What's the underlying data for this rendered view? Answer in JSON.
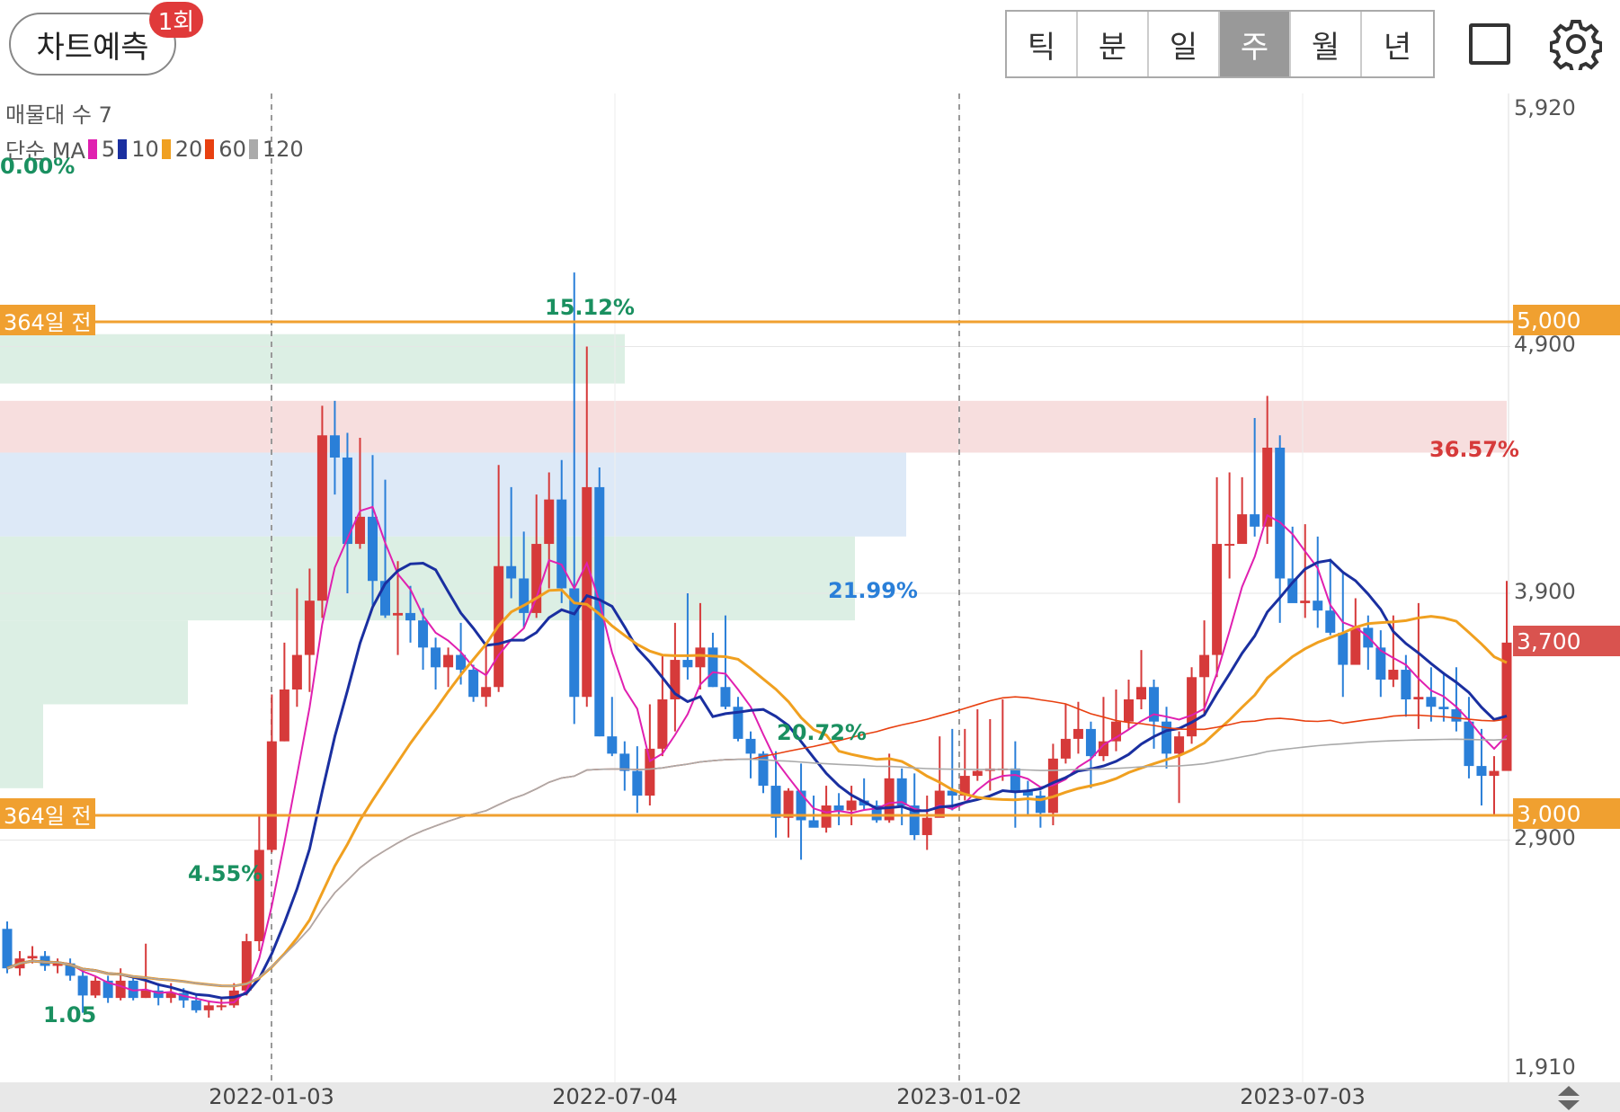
{
  "header": {
    "predict_label": "차트예측",
    "predict_badge": "1회",
    "period_tabs": [
      "틱",
      "분",
      "일",
      "주",
      "월",
      "년"
    ],
    "active_tab": "주"
  },
  "indicators": {
    "volume_profile": "매물대 수 7",
    "ma_title": "단순 MA",
    "ma_items": [
      {
        "label": "5",
        "color": "#e020b0"
      },
      {
        "label": "10",
        "color": "#1a2fa0"
      },
      {
        "label": "20",
        "color": "#f0a020"
      },
      {
        "label": "60",
        "color": "#e84010"
      },
      {
        "label": "120",
        "color": "#aaaaaa"
      }
    ],
    "zero_pct": "0.00%"
  },
  "price_axis": {
    "top": "5,920",
    "p4900": "4,900",
    "p3900": "3,900",
    "p2900": "2,900",
    "bottom": "1,910",
    "level_high": "5,000",
    "current": "3,700",
    "level_low": "3,000"
  },
  "levels": {
    "high_label": "364일 전",
    "low_label": "364일 전"
  },
  "zone_pcts": {
    "z1": "15.12%",
    "z2": "36.57%",
    "z3": "21.99%",
    "z4": "20.72%",
    "z5": "4.55%",
    "z6": "1.05"
  },
  "xaxis": [
    "2022-01-03",
    "2022-07-04",
    "2023-01-02",
    "2023-07-03"
  ],
  "colors": {
    "up": "#d63a3a",
    "down": "#2a7fd8",
    "level": "#f0a030",
    "current": "#d9534f"
  },
  "chart_data": {
    "type": "candlestick",
    "candles": [
      [
        2540,
        2380,
        2570,
        2360
      ],
      [
        2380,
        2420,
        2450,
        2350
      ],
      [
        2420,
        2430,
        2470,
        2400
      ],
      [
        2430,
        2390,
        2450,
        2370
      ],
      [
        2390,
        2400,
        2420,
        2360
      ],
      [
        2400,
        2350,
        2420,
        2330
      ],
      [
        2350,
        2270,
        2370,
        2200
      ],
      [
        2270,
        2330,
        2350,
        2260
      ],
      [
        2330,
        2260,
        2350,
        2240
      ],
      [
        2260,
        2330,
        2380,
        2250
      ],
      [
        2330,
        2260,
        2350,
        2250
      ],
      [
        2260,
        2290,
        2480,
        2260
      ],
      [
        2290,
        2260,
        2320,
        2230
      ],
      [
        2260,
        2280,
        2320,
        2240
      ],
      [
        2280,
        2250,
        2300,
        2220
      ],
      [
        2250,
        2210,
        2270,
        2200
      ],
      [
        2210,
        2230,
        2250,
        2180
      ],
      [
        2230,
        2230,
        2260,
        2210
      ],
      [
        2230,
        2290,
        2320,
        2220
      ],
      [
        2290,
        2490,
        2520,
        2270
      ],
      [
        2490,
        2860,
        3000,
        2450
      ],
      [
        2860,
        3300,
        3490,
        2850
      ],
      [
        3300,
        3510,
        3700,
        3300
      ],
      [
        3510,
        3650,
        3920,
        3440
      ],
      [
        3650,
        3870,
        4000,
        3500
      ],
      [
        3870,
        4540,
        4660,
        3800
      ],
      [
        4540,
        4450,
        4680,
        4300
      ],
      [
        4450,
        4100,
        4550,
        3900
      ],
      [
        4100,
        4210,
        4530,
        4080
      ],
      [
        4210,
        3950,
        4460,
        3850
      ],
      [
        3950,
        3810,
        4360,
        3800
      ],
      [
        3810,
        3820,
        4030,
        3650
      ],
      [
        3820,
        3790,
        3930,
        3700
      ],
      [
        3790,
        3680,
        3840,
        3590
      ],
      [
        3680,
        3600,
        3720,
        3510
      ],
      [
        3600,
        3650,
        3680,
        3520
      ],
      [
        3650,
        3590,
        3780,
        3530
      ],
      [
        3590,
        3480,
        3610,
        3460
      ],
      [
        3480,
        3520,
        3700,
        3440
      ],
      [
        3520,
        4010,
        4420,
        3500
      ],
      [
        4010,
        3960,
        4330,
        3880
      ],
      [
        3960,
        3820,
        4150,
        3760
      ],
      [
        3820,
        4100,
        4300,
        3800
      ],
      [
        4100,
        4280,
        4390,
        3920
      ],
      [
        4280,
        3920,
        4440,
        3860
      ],
      [
        3920,
        3480,
        5200,
        3370
      ],
      [
        3480,
        4330,
        4900,
        3440
      ],
      [
        4330,
        3320,
        4410,
        3320
      ],
      [
        3320,
        3250,
        3480,
        3240
      ],
      [
        3250,
        3180,
        3300,
        3100
      ],
      [
        3180,
        3080,
        3280,
        3010
      ],
      [
        3080,
        3270,
        3450,
        3040
      ],
      [
        3270,
        3470,
        3650,
        3240
      ],
      [
        3470,
        3630,
        3780,
        3340
      ],
      [
        3630,
        3600,
        3900,
        3550
      ],
      [
        3600,
        3680,
        3860,
        3510
      ],
      [
        3680,
        3520,
        3740,
        3520
      ],
      [
        3520,
        3440,
        3810,
        3430
      ],
      [
        3440,
        3310,
        3480,
        3300
      ],
      [
        3310,
        3250,
        3340,
        3150
      ],
      [
        3250,
        3120,
        3260,
        3090
      ],
      [
        3120,
        2990,
        3260,
        2910
      ],
      [
        2990,
        3100,
        3110,
        2910
      ],
      [
        3100,
        2980,
        3210,
        2820
      ],
      [
        2980,
        2950,
        3080,
        2960
      ],
      [
        2950,
        3040,
        3120,
        2930
      ],
      [
        3040,
        3020,
        3090,
        2960
      ],
      [
        3020,
        3060,
        3120,
        2960
      ],
      [
        3060,
        3040,
        3150,
        3020
      ],
      [
        3040,
        2980,
        3060,
        2970
      ],
      [
        2980,
        3150,
        3250,
        2970
      ],
      [
        3150,
        3040,
        3190,
        2960
      ],
      [
        3040,
        2920,
        3170,
        2900
      ],
      [
        2920,
        2990,
        3080,
        2860
      ],
      [
        2990,
        3100,
        3320,
        3010
      ],
      [
        3100,
        3080,
        3350,
        3020
      ],
      [
        3080,
        3160,
        3350,
        3060
      ],
      [
        3160,
        3180,
        3430,
        3140
      ],
      [
        3180,
        3190,
        3390,
        3100
      ],
      [
        3190,
        3190,
        3470,
        3140
      ],
      [
        3190,
        3100,
        3300,
        2950
      ],
      [
        3100,
        3080,
        3140,
        3000
      ],
      [
        3080,
        3010,
        3100,
        2950
      ],
      [
        3010,
        3230,
        3290,
        2960
      ],
      [
        3230,
        3310,
        3450,
        3210
      ],
      [
        3310,
        3350,
        3460,
        3250
      ],
      [
        3350,
        3240,
        3380,
        3110
      ],
      [
        3240,
        3300,
        3480,
        3220
      ],
      [
        3300,
        3380,
        3510,
        3260
      ],
      [
        3380,
        3470,
        3550,
        3350
      ],
      [
        3470,
        3520,
        3670,
        3430
      ],
      [
        3520,
        3380,
        3550,
        3270
      ],
      [
        3380,
        3250,
        3440,
        3190
      ],
      [
        3250,
        3320,
        3340,
        3050
      ],
      [
        3320,
        3560,
        3600,
        3290
      ],
      [
        3560,
        3650,
        3790,
        3410
      ],
      [
        3650,
        4100,
        4370,
        3560
      ],
      [
        4100,
        4100,
        4390,
        3960
      ],
      [
        4100,
        4220,
        4370,
        4120
      ],
      [
        4220,
        4170,
        4610,
        4130
      ],
      [
        4170,
        4490,
        4700,
        4100
      ],
      [
        4490,
        3960,
        4540,
        3780
      ],
      [
        3960,
        3860,
        4170,
        3930
      ],
      [
        3860,
        3870,
        4180,
        3800
      ],
      [
        3870,
        3830,
        4130,
        3760
      ],
      [
        3830,
        3740,
        4040,
        3730
      ],
      [
        3740,
        3610,
        3990,
        3480
      ],
      [
        3610,
        3760,
        3880,
        3610
      ],
      [
        3760,
        3680,
        3810,
        3590
      ],
      [
        3680,
        3550,
        3750,
        3480
      ],
      [
        3550,
        3590,
        3810,
        3520
      ],
      [
        3590,
        3470,
        3650,
        3400
      ],
      [
        3470,
        3480,
        3860,
        3350
      ],
      [
        3480,
        3440,
        3600,
        3380
      ],
      [
        3440,
        3430,
        3580,
        3380
      ],
      [
        3430,
        3380,
        3600,
        3340
      ],
      [
        3380,
        3200,
        3480,
        3150
      ],
      [
        3200,
        3160,
        3350,
        3040
      ],
      [
        3160,
        3180,
        3240,
        3000
      ],
      [
        3180,
        3700,
        3950,
        3560
      ]
    ],
    "levels": [
      5000,
      3000
    ],
    "current_price": 3700,
    "ylim": [
      1910,
      5920
    ],
    "x_labels": [
      "2022-01-03",
      "2022-07-04",
      "2023-01-02",
      "2023-07-03"
    ]
  }
}
